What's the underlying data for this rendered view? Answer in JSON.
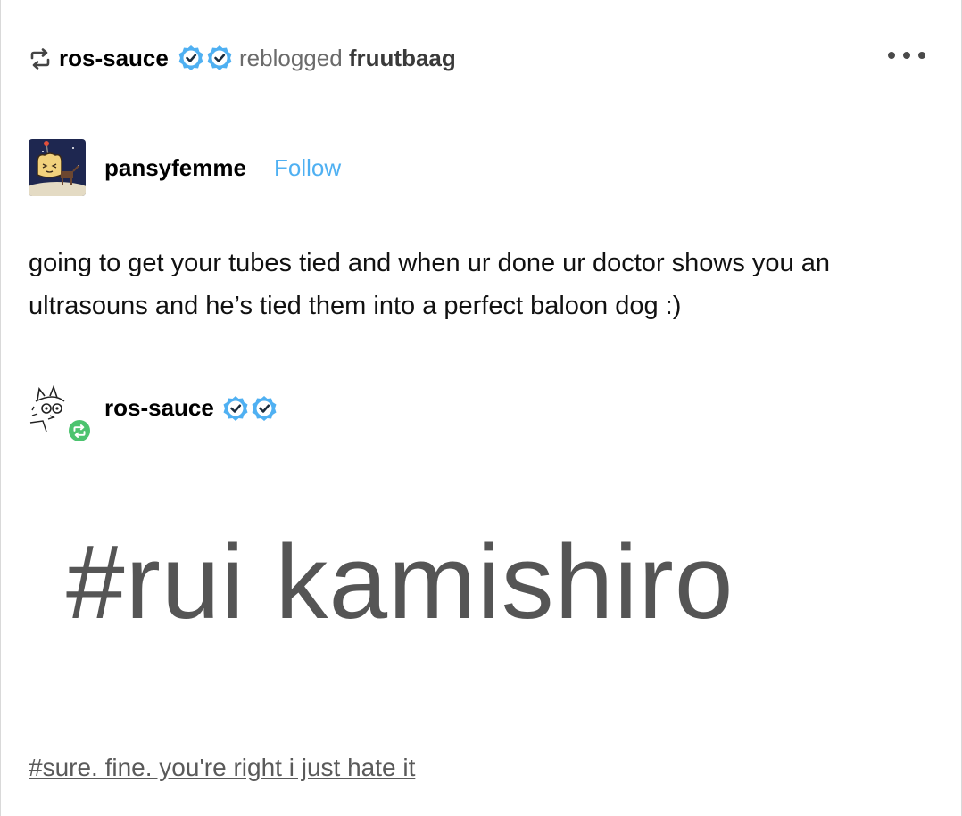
{
  "header": {
    "reblogger": "ros-sauce",
    "reblogged_text": "reblogged",
    "source": "fruutbaag",
    "more_icon": "more-horizontal-icon",
    "badge_color": "#4fb0f2"
  },
  "post1": {
    "author": "pansyfemme",
    "follow_label": "Follow",
    "body": "going to get your tubes tied and when ur done ur doctor shows you an ultrasouns and he’s tied them into a perfect baloon dog :)"
  },
  "post2": {
    "author": "ros-sauce",
    "image_text": "#rui kamishiro",
    "tag": "#sure. fine. you're right i just hate it",
    "reblog_badge_color": "#4cc36f"
  }
}
